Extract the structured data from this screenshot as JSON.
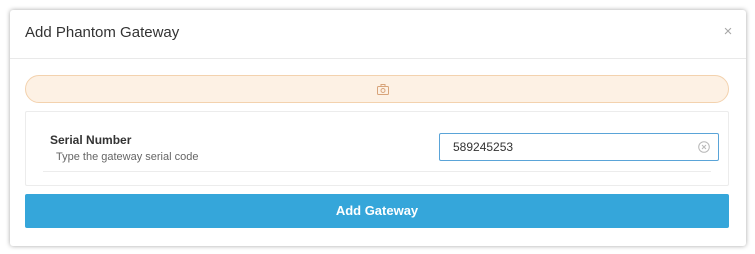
{
  "dialog": {
    "title": "Add Phantom Gateway",
    "close_icon": "close-icon",
    "close_glyph": "×"
  },
  "alert": {
    "icon": "camera-icon",
    "color": "#fdf1e4",
    "border_color": "#f3d2ae"
  },
  "form": {
    "serial_label": "Serial Number",
    "serial_help": "Type the gateway serial code",
    "serial_value": "589245253",
    "clear_icon": "clear-circle-icon"
  },
  "actions": {
    "submit_label": "Add Gateway",
    "submit_color": "#35a6da"
  }
}
